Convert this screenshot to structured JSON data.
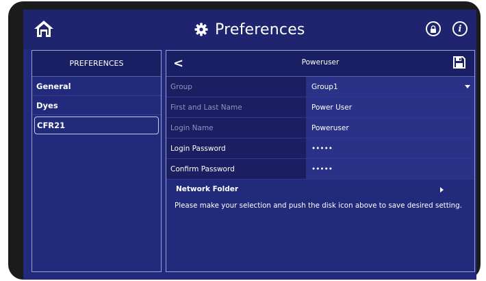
{
  "header": {
    "title": "Preferences",
    "icons": [
      "home-icon",
      "gear-icon",
      "lock-icon",
      "info-icon"
    ],
    "info_glyph": "i"
  },
  "left_panel": {
    "title": "PREFERENCES",
    "items": [
      {
        "label": "General",
        "selected": false
      },
      {
        "label": "Dyes",
        "selected": false
      },
      {
        "label": "CFR21",
        "selected": true
      }
    ]
  },
  "right_panel": {
    "title": "Poweruser",
    "back_glyph": "<",
    "fields": [
      {
        "label": "Group",
        "value": "Group1",
        "dropdown": true
      },
      {
        "label": "First and Last Name",
        "value": "Power User"
      },
      {
        "label": "Login Name",
        "value": "Poweruser"
      },
      {
        "label": "Login Password",
        "value": "•••••"
      },
      {
        "label": "Confirm Password",
        "value": "•••••"
      }
    ],
    "network_folder_label": "Network Folder",
    "instruction": "Please make your selection and push the disk icon above to save desired setting."
  },
  "colors": {
    "background": "#222a7c",
    "header": "#1e246e",
    "panel_header": "#191f63",
    "label_cell": "#1b1f61",
    "value_cell": "#2a3288",
    "bezel": "#1b1b1b"
  }
}
